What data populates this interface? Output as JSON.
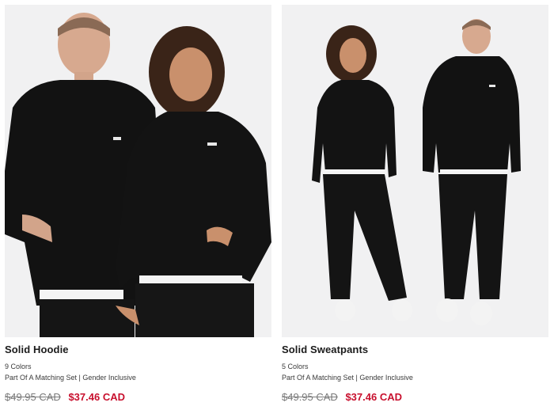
{
  "products": [
    {
      "name": "Solid Hoodie",
      "colors": "9 Colors",
      "tags": "Part Of A Matching Set | Gender Inclusive",
      "original_price": "$49.95 CAD",
      "sale_price": "$37.46 CAD"
    },
    {
      "name": "Solid Sweatpants",
      "colors": "5 Colors",
      "tags": "Part Of A Matching Set | Gender Inclusive",
      "original_price": "$49.95 CAD",
      "sale_price": "$37.46 CAD"
    }
  ],
  "colors": {
    "sale": "#c8102e",
    "photo_background": "#f1f1f2",
    "garment": "#111111"
  }
}
